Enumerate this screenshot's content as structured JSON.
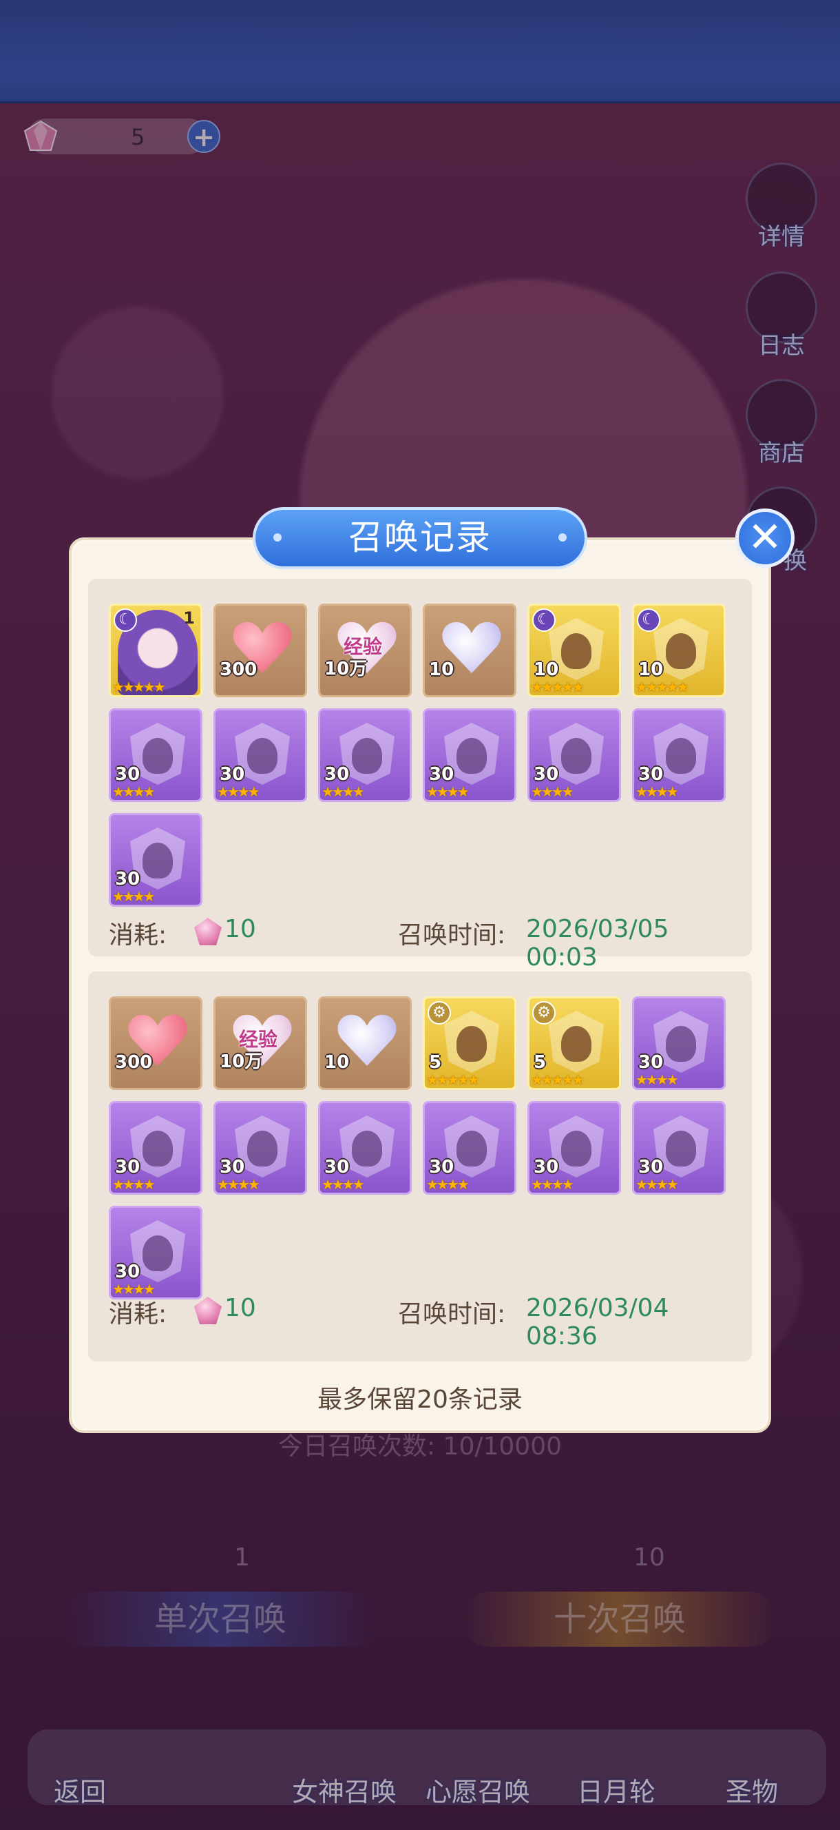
{
  "currency": {
    "value": "5",
    "plus_label": "+"
  },
  "side_buttons": [
    {
      "label": "详情",
      "icon": "magnifier-icon"
    },
    {
      "label": "日志",
      "icon": "book-icon"
    },
    {
      "label": "商店",
      "icon": "shop-icon"
    },
    {
      "label": "换",
      "icon": "swap-icon"
    }
  ],
  "modal": {
    "title": "召唤记录",
    "close_label": "✕",
    "footer_note": "最多保留20条记录",
    "records": [
      {
        "consume_label": "消耗:",
        "cost": "10",
        "time_label": "召唤时间:",
        "time": "2026/03/05 00:03",
        "items": [
          {
            "kind": "portrait",
            "qty": "",
            "corner": "1",
            "badge": "moon",
            "stars": "★★★★★"
          },
          {
            "kind": "heart",
            "qty": "300",
            "stars": ""
          },
          {
            "kind": "exp",
            "qty": "10万",
            "text": "经验",
            "stars": ""
          },
          {
            "kind": "crystal",
            "qty": "10",
            "stars": ""
          },
          {
            "kind": "gold",
            "qty": "10",
            "badge": "moon",
            "stars": "★★★★★"
          },
          {
            "kind": "gold",
            "qty": "10",
            "badge": "moon",
            "stars": "★★★★★"
          },
          {
            "kind": "purple",
            "qty": "30",
            "stars": "★★★★"
          },
          {
            "kind": "purple",
            "qty": "30",
            "stars": "★★★★"
          },
          {
            "kind": "purple",
            "qty": "30",
            "stars": "★★★★"
          },
          {
            "kind": "purple",
            "qty": "30",
            "stars": "★★★★"
          },
          {
            "kind": "purple",
            "qty": "30",
            "stars": "★★★★"
          },
          {
            "kind": "purple",
            "qty": "30",
            "stars": "★★★★"
          },
          {
            "kind": "purple",
            "qty": "30",
            "stars": "★★★★"
          }
        ]
      },
      {
        "consume_label": "消耗:",
        "cost": "10",
        "time_label": "召唤时间:",
        "time": "2026/03/04 08:36",
        "items": [
          {
            "kind": "heart",
            "qty": "300",
            "stars": ""
          },
          {
            "kind": "exp",
            "qty": "10万",
            "text": "经验",
            "stars": ""
          },
          {
            "kind": "crystal",
            "qty": "10",
            "stars": ""
          },
          {
            "kind": "gold",
            "qty": "5",
            "badge": "gear",
            "stars": "★★★★★"
          },
          {
            "kind": "gold",
            "qty": "5",
            "badge": "gear",
            "stars": "★★★★★"
          },
          {
            "kind": "purple",
            "qty": "30",
            "stars": "★★★★"
          },
          {
            "kind": "purple",
            "qty": "30",
            "stars": "★★★★"
          },
          {
            "kind": "purple",
            "qty": "30",
            "stars": "★★★★"
          },
          {
            "kind": "purple",
            "qty": "30",
            "stars": "★★★★"
          },
          {
            "kind": "purple",
            "qty": "30",
            "stars": "★★★★"
          },
          {
            "kind": "purple",
            "qty": "30",
            "stars": "★★★★"
          },
          {
            "kind": "purple",
            "qty": "30",
            "stars": "★★★★"
          },
          {
            "kind": "purple",
            "qty": "30",
            "stars": "★★★★"
          }
        ]
      }
    ]
  },
  "background": {
    "today_count": "今日召唤次数: 10/10000",
    "single_cost": "1",
    "ten_cost": "10",
    "single_label": "单次召唤",
    "ten_label": "十次召唤"
  },
  "nav": {
    "back": "返回",
    "goddess": "女神召唤",
    "wish": "心愿召唤",
    "sunmoon": "日月轮",
    "relic": "圣物"
  },
  "colors": {
    "accent_blue": "#2f6fdc",
    "time_green": "#2f8a5a",
    "panel_bg": "#f9f3ea"
  }
}
